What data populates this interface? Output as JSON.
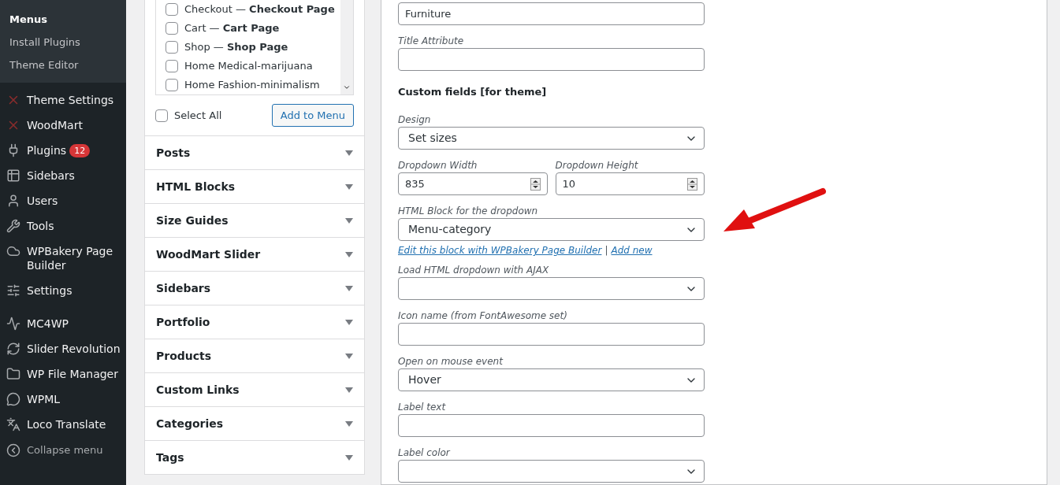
{
  "sidebar": {
    "submenu": [
      {
        "label": "Menus",
        "selected": true
      },
      {
        "label": "Install Plugins",
        "selected": false
      },
      {
        "label": "Theme Editor",
        "selected": false
      }
    ],
    "groups": [
      [
        {
          "label": "Theme Settings"
        },
        {
          "label": "WoodMart"
        },
        {
          "label": "Plugins",
          "badge": "12"
        },
        {
          "label": "Sidebars"
        },
        {
          "label": "Users"
        },
        {
          "label": "Tools"
        },
        {
          "label": "WPBakery Page Builder"
        },
        {
          "label": "Settings"
        }
      ],
      [
        {
          "label": "MC4WP"
        },
        {
          "label": "Slider Revolution"
        },
        {
          "label": "WP File Manager"
        },
        {
          "label": "WPML"
        },
        {
          "label": "Loco Translate"
        }
      ]
    ],
    "collapse": "Collapse menu"
  },
  "pages_box": {
    "items": [
      {
        "label": "Checkout — **Checkout Page**",
        "checked": false
      },
      {
        "label": "Cart — **Cart Page**",
        "checked": false
      },
      {
        "label": "Shop — **Shop Page**",
        "checked": false
      },
      {
        "label": "Home Medical-marijuana",
        "checked": false
      },
      {
        "label": "Home Fashion-minimalism",
        "checked": false
      }
    ],
    "select_all": {
      "label": "Select All",
      "checked": false
    },
    "add_button": "Add to Menu"
  },
  "sections": [
    {
      "title": "Posts",
      "expanded": false
    },
    {
      "title": "HTML Blocks",
      "expanded": false
    },
    {
      "title": "Size Guides",
      "expanded": false
    },
    {
      "title": "WoodMart Slider",
      "expanded": false
    },
    {
      "title": "Sidebars",
      "expanded": false
    },
    {
      "title": "Portfolio",
      "expanded": false
    },
    {
      "title": "Products",
      "expanded": false
    },
    {
      "title": "Custom Links",
      "expanded": false
    },
    {
      "title": "Categories",
      "expanded": false
    },
    {
      "title": "Tags",
      "expanded": false
    }
  ],
  "menu_item_settings": {
    "fields": [
      {
        "kind": "text",
        "value": "Furniture"
      },
      {
        "kind": "text",
        "label": "Title Attribute"
      },
      {
        "kind": "heading",
        "label": "Custom fields [for theme]"
      },
      {
        "kind": "select",
        "label": "Design",
        "value": "Set sizes"
      },
      {
        "kind": "pair",
        "items": [
          {
            "label": "Dropdown Width",
            "value": "835"
          },
          {
            "label": "Dropdown Height",
            "value": "10"
          }
        ]
      },
      {
        "kind": "select",
        "label": "HTML Block for the dropdown",
        "value": "Menu-category"
      },
      {
        "kind": "links",
        "items": [
          "Edit this block with WPBakery Page Builder",
          "Add new"
        ],
        "separator": "|"
      },
      {
        "kind": "select",
        "label": "Load HTML dropdown with AJAX"
      },
      {
        "kind": "text",
        "label": "Icon name (from FontAwesome set)"
      },
      {
        "kind": "select",
        "label": "Open on mouse event",
        "value": "Hover"
      },
      {
        "kind": "text",
        "label": "Label text"
      },
      {
        "kind": "select",
        "label": "Label color"
      }
    ]
  }
}
